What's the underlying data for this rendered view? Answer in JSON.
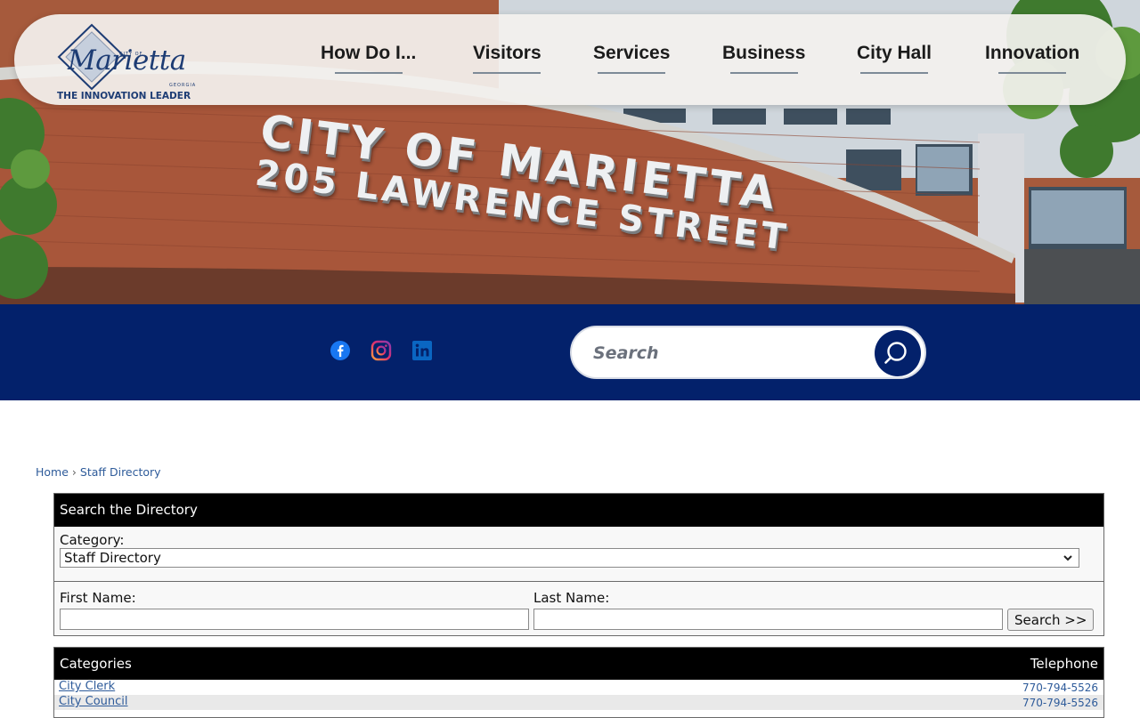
{
  "hero": {
    "building_line1": "CITY OF MARIETTA",
    "building_line2": "205 LAWRENCE STREET"
  },
  "logo": {
    "city_of": "CITY OF",
    "wordmark": "Marietta",
    "state": "GEORGIA",
    "tagline": "THE INNOVATION LEADER"
  },
  "nav": {
    "items": [
      {
        "label": "How Do I..."
      },
      {
        "label": "Visitors"
      },
      {
        "label": "Services"
      },
      {
        "label": "Business"
      },
      {
        "label": "City Hall"
      },
      {
        "label": "Innovation"
      }
    ]
  },
  "social": {
    "icons": [
      "facebook-icon",
      "instagram-icon",
      "linkedin-icon"
    ]
  },
  "search": {
    "placeholder": "Search"
  },
  "breadcrumb": {
    "home": "Home",
    "separator": "›",
    "current": "Staff Directory"
  },
  "directory": {
    "title": "Search the Directory",
    "category_label": "Category:",
    "category_value": "Staff Directory",
    "first_name_label": "First Name:",
    "last_name_label": "Last Name:",
    "search_button": "Search >>"
  },
  "categories": {
    "header": "Categories",
    "telephone_header": "Telephone",
    "rows": [
      {
        "name": "City Clerk",
        "phone": "770-794-5526"
      },
      {
        "name": "City Council",
        "phone": "770-794-5526"
      }
    ]
  },
  "colors": {
    "brand_navy": "#03216b",
    "logo_blue": "#1d3c74",
    "link": "#2e5b9a"
  }
}
